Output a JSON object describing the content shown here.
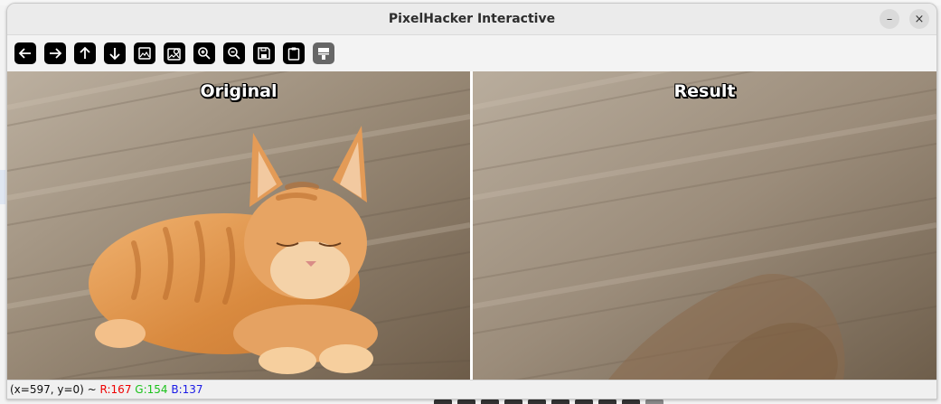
{
  "window": {
    "title": "PixelHacker Interactive",
    "minimize_icon": "–",
    "close_icon": "×"
  },
  "toolbar": {
    "buttons": [
      {
        "name": "pan-left",
        "icon": "arrow-left-icon"
      },
      {
        "name": "pan-right",
        "icon": "arrow-right-icon"
      },
      {
        "name": "pan-up",
        "icon": "arrow-up-icon"
      },
      {
        "name": "pan-down",
        "icon": "arrow-down-icon"
      },
      {
        "name": "zoom-fit",
        "icon": "image-icon"
      },
      {
        "name": "zoom-region",
        "icon": "image-zoom-icon"
      },
      {
        "name": "zoom-in",
        "icon": "zoom-in-icon"
      },
      {
        "name": "zoom-out",
        "icon": "zoom-out-icon"
      },
      {
        "name": "save-image",
        "icon": "save-icon"
      },
      {
        "name": "copy-clipboard",
        "icon": "clipboard-icon"
      },
      {
        "name": "properties",
        "icon": "properties-icon",
        "disabled": true
      }
    ]
  },
  "panels": {
    "left_label": "Original",
    "right_label": "Result"
  },
  "status": {
    "position": "(x=597, y=0) ~ ",
    "r": "R:167",
    "g": "G:154",
    "b": "B:137"
  },
  "colors": {
    "wood_light": "#b8aa98",
    "wood_dark": "#6a5a48",
    "cat_orange": "#e0964a",
    "status_r": "#e00000",
    "status_g": "#1bc21b",
    "status_b": "#1a1ae6"
  }
}
